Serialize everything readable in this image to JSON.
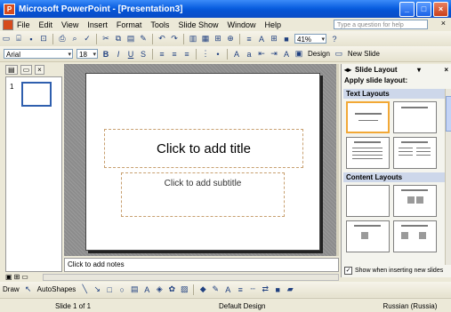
{
  "window": {
    "title": "Microsoft PowerPoint - [Presentation3]",
    "app_icon": "powerpoint-icon"
  },
  "menu": {
    "items": [
      {
        "label": "File"
      },
      {
        "label": "Edit"
      },
      {
        "label": "View"
      },
      {
        "label": "Insert"
      },
      {
        "label": "Format"
      },
      {
        "label": "Tools"
      },
      {
        "label": "Slide Show"
      },
      {
        "label": "Window"
      },
      {
        "label": "Help"
      }
    ],
    "help_placeholder": "Type a question for help"
  },
  "toolbar": {
    "zoom": "41%"
  },
  "formatting": {
    "font": "Arial",
    "size": "18",
    "design_label": "Design",
    "new_slide_label": "New Slide"
  },
  "slides_pane": {
    "thumb_number": "1"
  },
  "slide": {
    "title_placeholder": "Click to add title",
    "subtitle_placeholder": "Click to add subtitle"
  },
  "notes": {
    "placeholder": "Click to add notes"
  },
  "task_pane": {
    "title": "Slide Layout",
    "apply_label": "Apply slide layout:",
    "group_text": "Text Layouts",
    "group_content": "Content Layouts",
    "checkbox_label": "Show when inserting new slides"
  },
  "drawing": {
    "draw_label": "Draw",
    "autoshapes_label": "AutoShapes"
  },
  "status": {
    "slide": "Slide 1 of 1",
    "design": "Default Design",
    "language": "Russian (Russia)"
  },
  "colors": {
    "titlebar": "#0a5fe0",
    "selection": "#f2a836"
  }
}
